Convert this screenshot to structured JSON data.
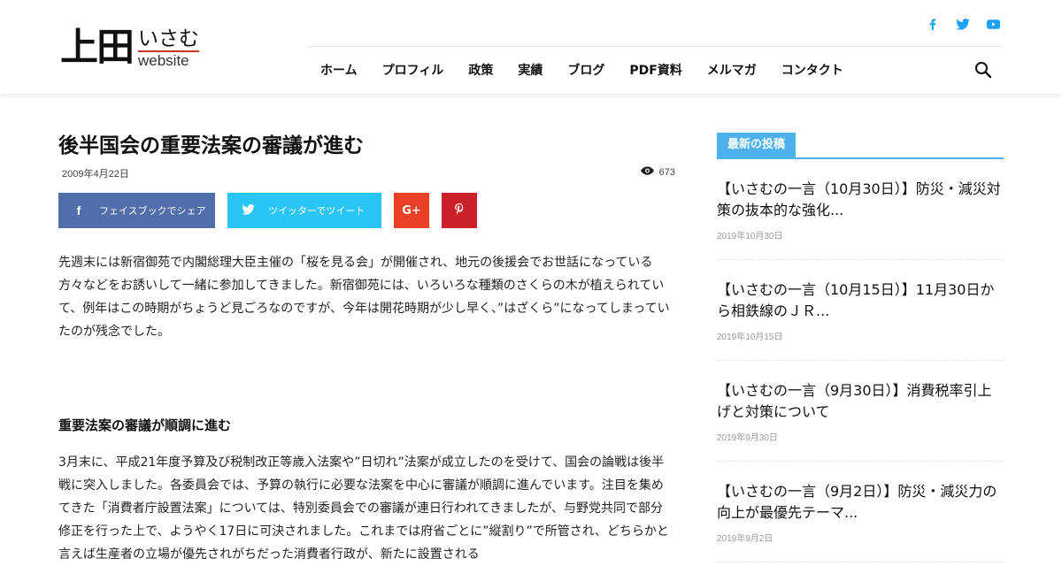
{
  "logo": {
    "kanji": "上田",
    "kana": "いさむ",
    "sub": "website"
  },
  "social": {
    "facebook": "f",
    "twitter": "t",
    "youtube": "▶",
    "color": "#1da1f2"
  },
  "nav": [
    "ホーム",
    "プロフィル",
    "政策",
    "実績",
    "ブログ",
    "PDF資料",
    "メルマガ",
    "コンタクト"
  ],
  "article": {
    "title": "後半国会の重要法案の審議が進む",
    "date": "2009年4月22日",
    "views": "673",
    "share": {
      "facebook": "フェイスブックでシェア",
      "twitter": "ツイッターでツイート",
      "gplus": "G+"
    },
    "para1": "先週末には新宿御苑で内閣総理大臣主催の「桜を見る会」が開催され、地元の後援会でお世話になっている方々などをお誘いして一緒に参加してきました。新宿御苑には、いろいろな種類のさくらの木が植えられていて、例年はこの時期がちょうど見ごろなのですが、今年は開花時期が少し早く、”はざくら”になってしまっていたのが残念でした。",
    "subhead": "重要法案の審議が順調に進む",
    "para2": "3月末に、平成21年度予算及び税制改正等歳入法案や”日切れ”法案が成立したのを受けて、国会の論戦は後半戦に突入しました。各委員会では、予算の執行に必要な法案を中心に審議が順調に進んでいます。注目を集めてきた「消費者庁設置法案」については、特別委員会での審議が連日行われてきましたが、与野党共同で部分修正を行った上で、ようやく17日に可決されました。これまでは府省ごとに”縦割り”で所管され、どちらかと言えば生産者の立場が優先されがちだった消費者行政が、新たに設置される"
  },
  "sidebar": {
    "heading": "最新の投稿",
    "posts": [
      {
        "title": "【いさむの一言（10月30日）】防災・減災対策の抜本的な強化...",
        "date": "2019年10月30日"
      },
      {
        "title": "【いさむの一言（10月15日）】11月30日から相鉄線のＪＲ...",
        "date": "2019年10月15日"
      },
      {
        "title": "【いさむの一言（9月30日）】消費税率引上げと対策について",
        "date": "2019年9月30日"
      },
      {
        "title": "【いさむの一言（9月2日）】防災・減災力の向上が最優先テーマ...",
        "date": "2019年9月2日"
      }
    ]
  }
}
